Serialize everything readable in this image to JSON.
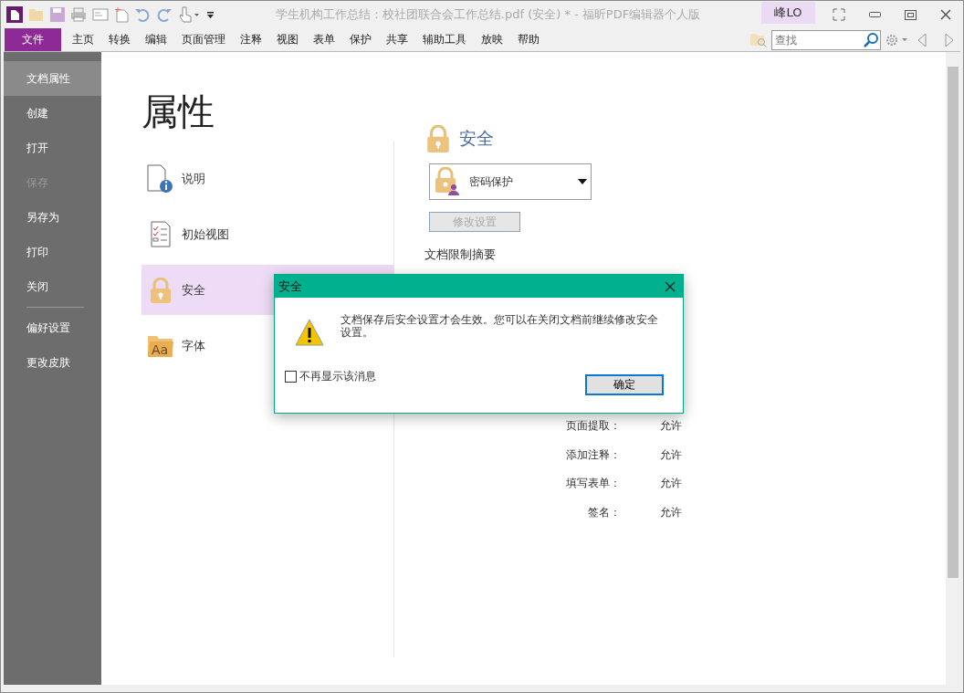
{
  "window": {
    "title": "学生机构工作总结：校社团联合会工作总结.pdf (安全) * - 福昕PDF编辑器个人版",
    "user": "峰LO"
  },
  "menu": [
    {
      "label": "文件",
      "selected": true
    },
    {
      "label": "主页",
      "selected": false
    },
    {
      "label": "转换",
      "selected": false
    },
    {
      "label": "编辑",
      "selected": false
    },
    {
      "label": "页面管理",
      "selected": false
    },
    {
      "label": "注释",
      "selected": false
    },
    {
      "label": "视图",
      "selected": false
    },
    {
      "label": "表单",
      "selected": false
    },
    {
      "label": "保护",
      "selected": false
    },
    {
      "label": "共享",
      "selected": false
    },
    {
      "label": "辅助工具",
      "selected": false
    },
    {
      "label": "放映",
      "selected": false
    },
    {
      "label": "帮助",
      "selected": false
    }
  ],
  "search": {
    "placeholder": "查找"
  },
  "sidebar": {
    "items": [
      {
        "label": "文档属性",
        "selected": true,
        "disabled": false
      },
      {
        "label": "创建",
        "selected": false,
        "disabled": false
      },
      {
        "label": "打开",
        "selected": false,
        "disabled": false
      },
      {
        "label": "保存",
        "selected": false,
        "disabled": true
      },
      {
        "label": "另存为",
        "selected": false,
        "disabled": false
      },
      {
        "label": "打印",
        "selected": false,
        "disabled": false
      },
      {
        "label": "关闭",
        "selected": false,
        "disabled": false
      }
    ],
    "settings_items": [
      {
        "label": "偏好设置",
        "selected": false,
        "disabled": false
      },
      {
        "label": "更改皮肤",
        "selected": false,
        "disabled": false
      }
    ]
  },
  "properties": {
    "title": "属性",
    "sections": [
      {
        "label": "说明",
        "kind": "info",
        "selected": false
      },
      {
        "label": "初始视图",
        "kind": "view",
        "selected": false
      },
      {
        "label": "安全",
        "kind": "lock",
        "selected": true
      },
      {
        "label": "字体",
        "kind": "font",
        "icon_text": "Aa",
        "selected": false
      }
    ]
  },
  "security": {
    "title": "安全",
    "method": "密码保护",
    "button": {
      "label": "修改设置",
      "disabled": true
    },
    "summary_title": "文档限制摘要",
    "restrictions": [
      {
        "name": "页面提取：",
        "value": "允许"
      },
      {
        "name": "添加注释：",
        "value": "允许"
      },
      {
        "name": "填写表单：",
        "value": "允许"
      },
      {
        "name": "签名：",
        "value": "允许"
      }
    ]
  },
  "dialog": {
    "title": "安全",
    "message": "文档保存后安全设置才会生效。您可以在关闭文档前继续修改安全设置。",
    "checkbox": {
      "label": "不再显示该消息",
      "checked": false
    },
    "button": "确定"
  }
}
